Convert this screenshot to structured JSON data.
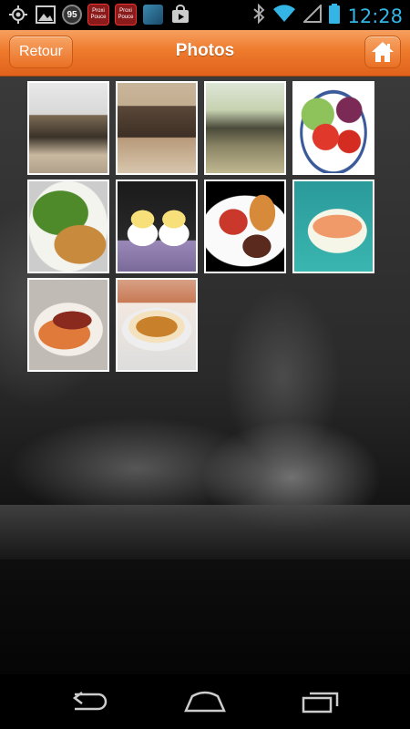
{
  "status_bar": {
    "time": "12:28",
    "notifications": [
      {
        "name": "gps-icon"
      },
      {
        "name": "image-icon"
      },
      {
        "name": "badge-95",
        "label": "95"
      },
      {
        "name": "app-icon-1",
        "label": "Proxi Pouce"
      },
      {
        "name": "app-icon-2",
        "label": "Proxi Pouce"
      },
      {
        "name": "app-icon-3"
      },
      {
        "name": "store-icon"
      }
    ],
    "system_icons": [
      "bluetooth-icon",
      "wifi-icon",
      "signal-icon",
      "battery-icon"
    ]
  },
  "header": {
    "back_label": "Retour",
    "title": "Photos",
    "accent_color": "#ee7a2c"
  },
  "gallery": {
    "items": [
      {
        "name": "photo-restaurant-interior"
      },
      {
        "name": "photo-banquette-seating"
      },
      {
        "name": "photo-dining-room"
      },
      {
        "name": "photo-tomato-salad"
      },
      {
        "name": "photo-breaded-cutlet-salad"
      },
      {
        "name": "photo-deviled-eggs"
      },
      {
        "name": "photo-grilled-plate"
      },
      {
        "name": "photo-salmon-dish"
      },
      {
        "name": "photo-steak-dish"
      },
      {
        "name": "photo-creme-brulee"
      }
    ]
  },
  "nav_bar": {
    "buttons": [
      "back-nav-icon",
      "home-nav-icon",
      "recents-nav-icon"
    ]
  }
}
